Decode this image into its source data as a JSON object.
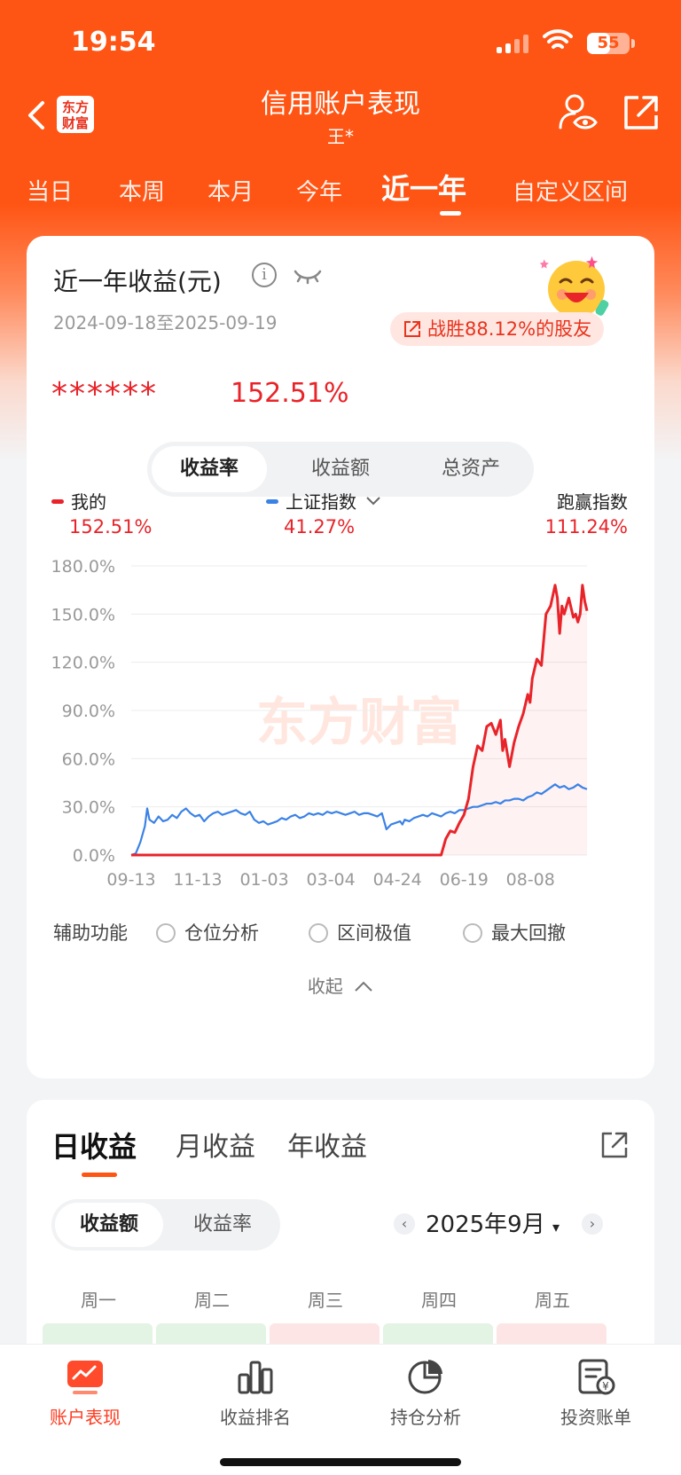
{
  "status_bar": {
    "time": "19:54",
    "battery": "55",
    "battery_level_pct": 55
  },
  "header": {
    "title": "信用账户表现",
    "subtitle": "王*",
    "logo_text": "东方\n财富"
  },
  "period_tabs": [
    "当日",
    "本周",
    "本月",
    "今年",
    "近一年",
    "自定义区间"
  ],
  "period_active_index": 4,
  "summary": {
    "title": "近一年收益(元)",
    "date_range": "2024-09-18至2025-09-19",
    "badge": "战胜88.12%的股友",
    "masked_amount": "******",
    "return_pct": "152.51%"
  },
  "metric_tabs": [
    "收益率",
    "收益额",
    "总资产"
  ],
  "metric_active_index": 0,
  "legend": {
    "mine_label": "我的",
    "mine_value": "152.51%",
    "index_label": "上证指数",
    "index_value": "41.27%",
    "beat_label": "跑赢指数",
    "beat_value": "111.24%"
  },
  "colors": {
    "brand": "#ff5514",
    "mine": "#e8242a",
    "index": "#3b82e6",
    "positive": "#e8242a"
  },
  "chart_data": {
    "type": "line",
    "y_ticks": [
      "180.0%",
      "150.0%",
      "120.0%",
      "90.0%",
      "60.0%",
      "30.0%",
      "0.0%"
    ],
    "ylim": [
      0,
      180
    ],
    "x_ticks": [
      "09-13",
      "11-13",
      "01-03",
      "03-04",
      "04-24",
      "06-19",
      "08-08"
    ],
    "x_tick_positions": [
      0,
      0.146,
      0.292,
      0.438,
      0.584,
      0.73,
      0.876
    ],
    "watermark": "东方财富",
    "grid": true,
    "series": [
      {
        "name": "我的",
        "color": "#e8242a",
        "x": [
          0,
          0.68,
          0.69,
          0.7,
          0.71,
          0.72,
          0.73,
          0.74,
          0.75,
          0.76,
          0.77,
          0.78,
          0.79,
          0.8,
          0.81,
          0.815,
          0.82,
          0.83,
          0.84,
          0.85,
          0.86,
          0.87,
          0.875,
          0.88,
          0.89,
          0.9,
          0.91,
          0.92,
          0.93,
          0.935,
          0.94,
          0.945,
          0.95,
          0.96,
          0.97,
          0.975,
          0.98,
          0.985,
          0.99,
          0.995,
          1.0
        ],
        "y": [
          0,
          0,
          10,
          15,
          14,
          20,
          25,
          35,
          55,
          68,
          65,
          80,
          82,
          75,
          84,
          65,
          72,
          55,
          70,
          80,
          88,
          100,
          95,
          110,
          122,
          118,
          150,
          155,
          168,
          160,
          138,
          155,
          150,
          160,
          148,
          150,
          145,
          150,
          168,
          158,
          152
        ]
      },
      {
        "name": "上证指数",
        "color": "#3b82e6",
        "x": [
          0,
          0.01,
          0.02,
          0.03,
          0.035,
          0.04,
          0.05,
          0.06,
          0.07,
          0.08,
          0.09,
          0.1,
          0.11,
          0.12,
          0.13,
          0.14,
          0.15,
          0.16,
          0.17,
          0.18,
          0.19,
          0.2,
          0.21,
          0.22,
          0.23,
          0.24,
          0.25,
          0.26,
          0.27,
          0.28,
          0.29,
          0.3,
          0.31,
          0.32,
          0.33,
          0.34,
          0.35,
          0.36,
          0.37,
          0.38,
          0.39,
          0.4,
          0.41,
          0.42,
          0.43,
          0.44,
          0.45,
          0.46,
          0.47,
          0.48,
          0.49,
          0.5,
          0.51,
          0.52,
          0.53,
          0.54,
          0.55,
          0.56,
          0.57,
          0.58,
          0.59,
          0.595,
          0.6,
          0.61,
          0.62,
          0.63,
          0.64,
          0.65,
          0.66,
          0.67,
          0.68,
          0.69,
          0.7,
          0.71,
          0.72,
          0.73,
          0.74,
          0.75,
          0.76,
          0.77,
          0.78,
          0.79,
          0.8,
          0.81,
          0.82,
          0.83,
          0.84,
          0.85,
          0.86,
          0.87,
          0.88,
          0.89,
          0.9,
          0.91,
          0.92,
          0.93,
          0.94,
          0.95,
          0.96,
          0.97,
          0.98,
          0.99,
          1.0
        ],
        "y": [
          0,
          1,
          8,
          18,
          29,
          22,
          20,
          24,
          21,
          22,
          25,
          23,
          27,
          29,
          26,
          24,
          25,
          21,
          24,
          26,
          27,
          25,
          26,
          27,
          28,
          26,
          25,
          27,
          22,
          20,
          21,
          19,
          20,
          21,
          23,
          22,
          24,
          25,
          23,
          24,
          26,
          25,
          26,
          25,
          27,
          26,
          27,
          26,
          25,
          26,
          27,
          25,
          26,
          26,
          25,
          24,
          26,
          16,
          19,
          20,
          21,
          19,
          22,
          21,
          23,
          24,
          25,
          24,
          26,
          25,
          24,
          26,
          27,
          26,
          28,
          28,
          29,
          30,
          30,
          31,
          32,
          32,
          33,
          32,
          34,
          34,
          35,
          35,
          34,
          36,
          37,
          39,
          38,
          40,
          42,
          44,
          42,
          43,
          41,
          42,
          44,
          42,
          41
        ]
      }
    ]
  },
  "aux": {
    "label": "辅助功能",
    "items": [
      "仓位分析",
      "区间极值",
      "最大回撤"
    ]
  },
  "collapse_label": "收起",
  "returns": {
    "tabs": [
      "日收益",
      "月收益",
      "年收益"
    ],
    "active_index": 0,
    "seg": [
      "收益额",
      "收益率"
    ],
    "seg_active_index": 0,
    "month": "2025年9月",
    "weekdays": [
      "周一",
      "周二",
      "周三",
      "周四",
      "周五"
    ]
  },
  "bottom_nav": [
    "账户表现",
    "收益排名",
    "持仓分析",
    "投资账单"
  ],
  "bottom_nav_active_index": 0
}
